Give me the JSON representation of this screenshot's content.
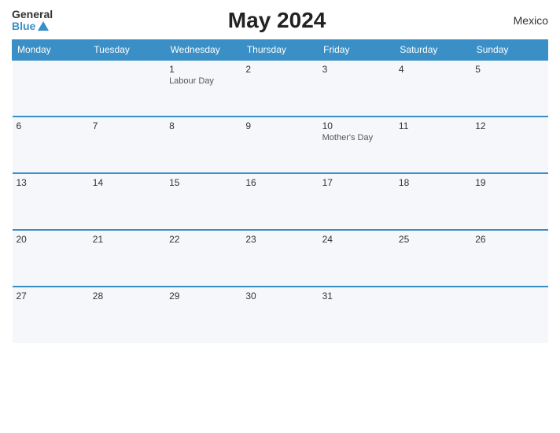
{
  "header": {
    "logo_general": "General",
    "logo_blue": "Blue",
    "title": "May 2024",
    "country": "Mexico"
  },
  "calendar": {
    "days": [
      "Monday",
      "Tuesday",
      "Wednesday",
      "Thursday",
      "Friday",
      "Saturday",
      "Sunday"
    ],
    "weeks": [
      [
        {
          "num": "",
          "holiday": ""
        },
        {
          "num": "",
          "holiday": ""
        },
        {
          "num": "1",
          "holiday": "Labour Day"
        },
        {
          "num": "2",
          "holiday": ""
        },
        {
          "num": "3",
          "holiday": ""
        },
        {
          "num": "4",
          "holiday": ""
        },
        {
          "num": "5",
          "holiday": ""
        }
      ],
      [
        {
          "num": "6",
          "holiday": ""
        },
        {
          "num": "7",
          "holiday": ""
        },
        {
          "num": "8",
          "holiday": ""
        },
        {
          "num": "9",
          "holiday": ""
        },
        {
          "num": "10",
          "holiday": "Mother's Day"
        },
        {
          "num": "11",
          "holiday": ""
        },
        {
          "num": "12",
          "holiday": ""
        }
      ],
      [
        {
          "num": "13",
          "holiday": ""
        },
        {
          "num": "14",
          "holiday": ""
        },
        {
          "num": "15",
          "holiday": ""
        },
        {
          "num": "16",
          "holiday": ""
        },
        {
          "num": "17",
          "holiday": ""
        },
        {
          "num": "18",
          "holiday": ""
        },
        {
          "num": "19",
          "holiday": ""
        }
      ],
      [
        {
          "num": "20",
          "holiday": ""
        },
        {
          "num": "21",
          "holiday": ""
        },
        {
          "num": "22",
          "holiday": ""
        },
        {
          "num": "23",
          "holiday": ""
        },
        {
          "num": "24",
          "holiday": ""
        },
        {
          "num": "25",
          "holiday": ""
        },
        {
          "num": "26",
          "holiday": ""
        }
      ],
      [
        {
          "num": "27",
          "holiday": ""
        },
        {
          "num": "28",
          "holiday": ""
        },
        {
          "num": "29",
          "holiday": ""
        },
        {
          "num": "30",
          "holiday": ""
        },
        {
          "num": "31",
          "holiday": ""
        },
        {
          "num": "",
          "holiday": ""
        },
        {
          "num": "",
          "holiday": ""
        }
      ]
    ]
  }
}
